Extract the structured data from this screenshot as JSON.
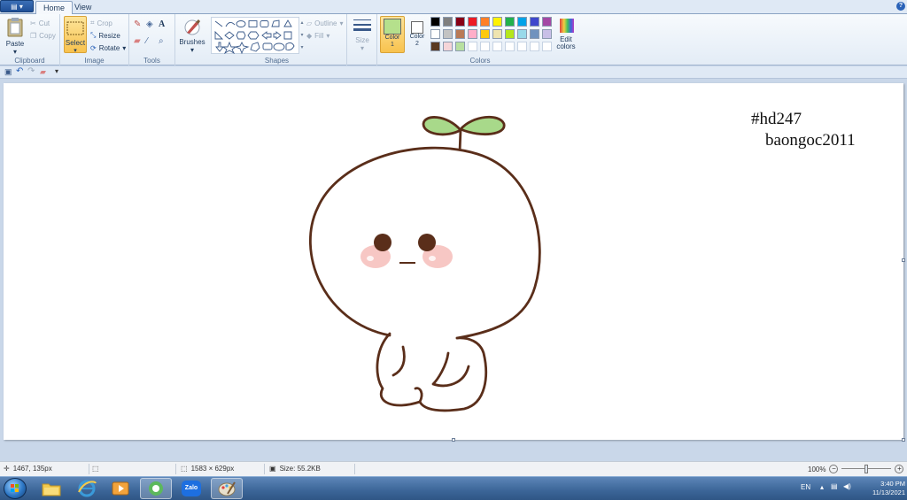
{
  "tabs": {
    "file_label": "▤ ▾",
    "home": "Home",
    "view": "View"
  },
  "help": "?",
  "clipboard": {
    "paste": "Paste",
    "cut": "Cut",
    "copy": "Copy",
    "label": "Clipboard"
  },
  "image": {
    "select": "Select",
    "crop": "Crop",
    "resize": "Resize",
    "rotate": "Rotate",
    "label": "Image"
  },
  "tools": {
    "label": "Tools"
  },
  "brushes": {
    "label": "Brushes"
  },
  "shapes": {
    "outline": "Outline",
    "fill": "Fill",
    "label": "Shapes"
  },
  "size": {
    "label": "Size"
  },
  "colors": {
    "color1_label": "Color 1",
    "color2_label": "Color 2",
    "edit_label": "Edit colors",
    "group_label": "Colors",
    "color1": "#b5e08c",
    "color2": "#ffffff",
    "palette_row1": [
      "#000000",
      "#7f7f7f",
      "#880015",
      "#ed1c24",
      "#ff7f27",
      "#fff200",
      "#22b14c",
      "#00a2e8",
      "#3f48cc",
      "#a349a4"
    ],
    "palette_row2": [
      "#ffffff",
      "#c3c3c3",
      "#b97a57",
      "#ffaec9",
      "#ffc90e",
      "#efe4b0",
      "#b5e61d",
      "#99d9ea",
      "#7092be",
      "#c8bfe7"
    ],
    "palette_row3": [
      "#5a3a22",
      "#f5d5d8",
      "#b8e0a0",
      "#ffffff",
      "#ffffff",
      "#ffffff",
      "#ffffff",
      "#ffffff",
      "#ffffff",
      "#ffffff"
    ]
  },
  "canvas": {
    "text_line1": "#hd247",
    "text_line2": "baongoc2011"
  },
  "status": {
    "cursor_pos": "1467, 135px",
    "dimensions": "1583 × 629px",
    "size": "Size: 55.2KB",
    "zoom": "100%"
  },
  "taskbar": {
    "zalo": "Zalo",
    "lang": "EN",
    "time": "3:40 PM",
    "date": "11/13/2021"
  }
}
